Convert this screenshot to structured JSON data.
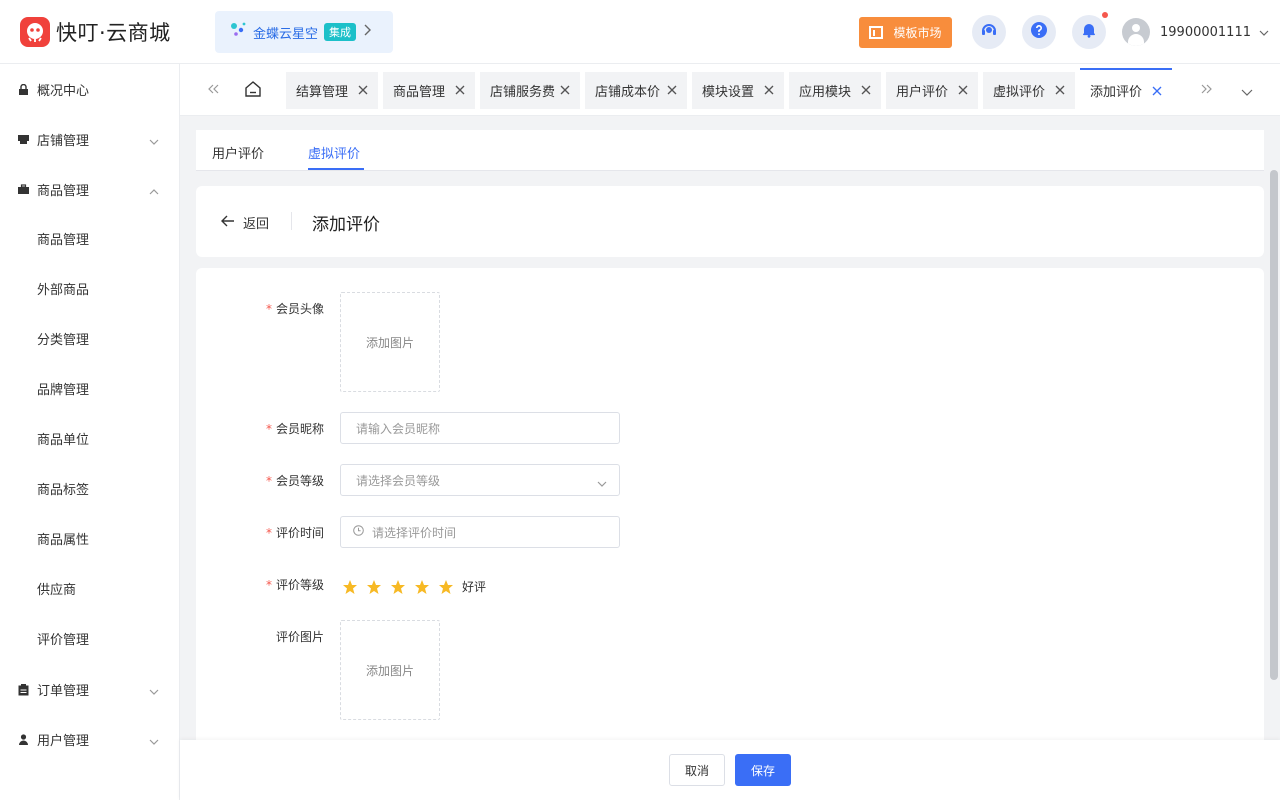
{
  "header": {
    "brand": "快叮·云商城",
    "integration": {
      "label": "金蝶云星空",
      "tag": "集成"
    },
    "template_market": "模板市场",
    "user_phone": "19900001111"
  },
  "sidebar": {
    "groups": [
      {
        "label": "概况中心"
      },
      {
        "label": "店铺管理"
      },
      {
        "label": "商品管理"
      },
      {
        "label": "订单管理"
      },
      {
        "label": "用户管理"
      }
    ],
    "goods_items": [
      "商品管理",
      "外部商品",
      "分类管理",
      "品牌管理",
      "商品单位",
      "商品标签",
      "商品属性",
      "供应商",
      "评价管理"
    ]
  },
  "tabs": [
    "结算管理",
    "商品管理",
    "店铺服务费",
    "店铺成本价",
    "模块设置",
    "应用模块",
    "用户评价",
    "虚拟评价",
    "添加评价"
  ],
  "subtabs": {
    "user_review": "用户评价",
    "virtual_review": "虚拟评价"
  },
  "title_bar": {
    "back": "返回",
    "title": "添加评价"
  },
  "form": {
    "avatar": {
      "label": "会员头像",
      "upload": "添加图片"
    },
    "nickname": {
      "label": "会员昵称",
      "placeholder": "请输入会员昵称"
    },
    "level": {
      "label": "会员等级",
      "placeholder": "请选择会员等级"
    },
    "time": {
      "label": "评价时间",
      "placeholder": "请选择评价时间"
    },
    "rating": {
      "label": "评价等级",
      "stars": 5,
      "text": "好评"
    },
    "images": {
      "label": "评价图片",
      "upload": "添加图片"
    }
  },
  "footer": {
    "cancel": "取消",
    "save": "保存"
  },
  "colors": {
    "accent": "#3a6ef6",
    "star": "#f7b924",
    "brand": "#f0413b",
    "orange": "#f88d3c"
  }
}
